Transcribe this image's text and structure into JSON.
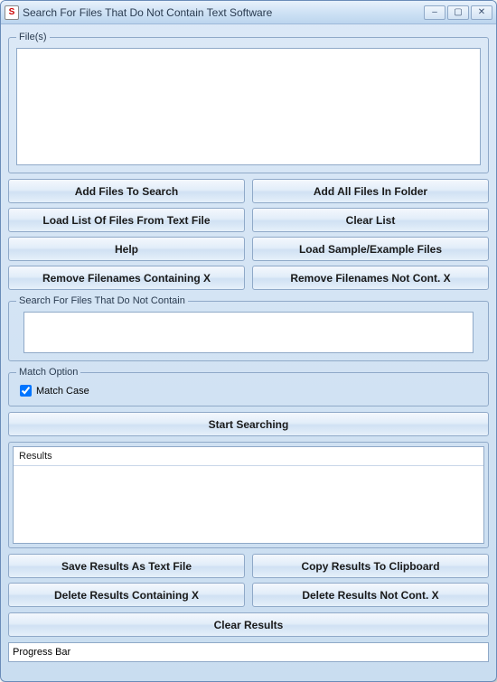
{
  "window": {
    "title": "Search For Files That Do Not Contain Text Software"
  },
  "files_group": {
    "legend": "File(s)"
  },
  "buttons_top": {
    "add_files": "Add Files To Search",
    "add_all_folder": "Add All Files In Folder",
    "load_list": "Load List Of Files From Text File",
    "clear_list": "Clear List",
    "help": "Help",
    "load_sample": "Load Sample/Example Files",
    "remove_containing": "Remove Filenames Containing X",
    "remove_not_containing": "Remove Filenames Not Cont. X"
  },
  "search_group": {
    "legend": "Search For Files That Do Not Contain",
    "value": ""
  },
  "match_group": {
    "legend": "Match Option",
    "match_case_label": "Match Case",
    "match_case_checked": true
  },
  "start_search": "Start Searching",
  "results_group": {
    "header": "Results"
  },
  "buttons_bottom": {
    "save_results": "Save Results As Text File",
    "copy_results": "Copy Results To Clipboard",
    "delete_containing": "Delete Results Containing X",
    "delete_not_containing": "Delete Results Not Cont. X",
    "clear_results": "Clear Results"
  },
  "status": {
    "text": "Progress Bar"
  }
}
